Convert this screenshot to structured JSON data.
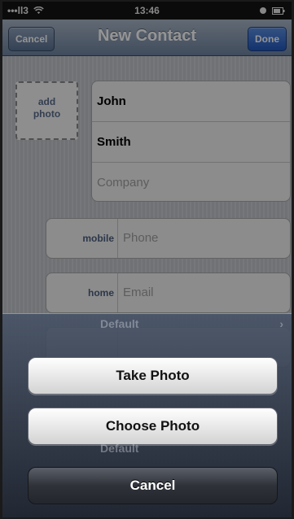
{
  "status_bar": {
    "signal": "•••ll3",
    "wifi_icon": "wifi-icon",
    "time": "13:46",
    "battery_icon": "battery-icon"
  },
  "nav": {
    "cancel": "Cancel",
    "title": "New Contact",
    "done": "Done"
  },
  "photo": {
    "label_line1": "add",
    "label_line2": "photo"
  },
  "name_fields": {
    "first": "John",
    "last": "Smith",
    "company_placeholder": "Company"
  },
  "phone": {
    "label": "mobile",
    "placeholder": "Phone"
  },
  "email": {
    "label": "home",
    "placeholder": "Email"
  },
  "ghost": {
    "ringtone_value": "Default",
    "text_tone_value": "Default"
  },
  "action_sheet": {
    "take_photo": "Take Photo",
    "choose_photo": "Choose Photo",
    "cancel": "Cancel"
  }
}
